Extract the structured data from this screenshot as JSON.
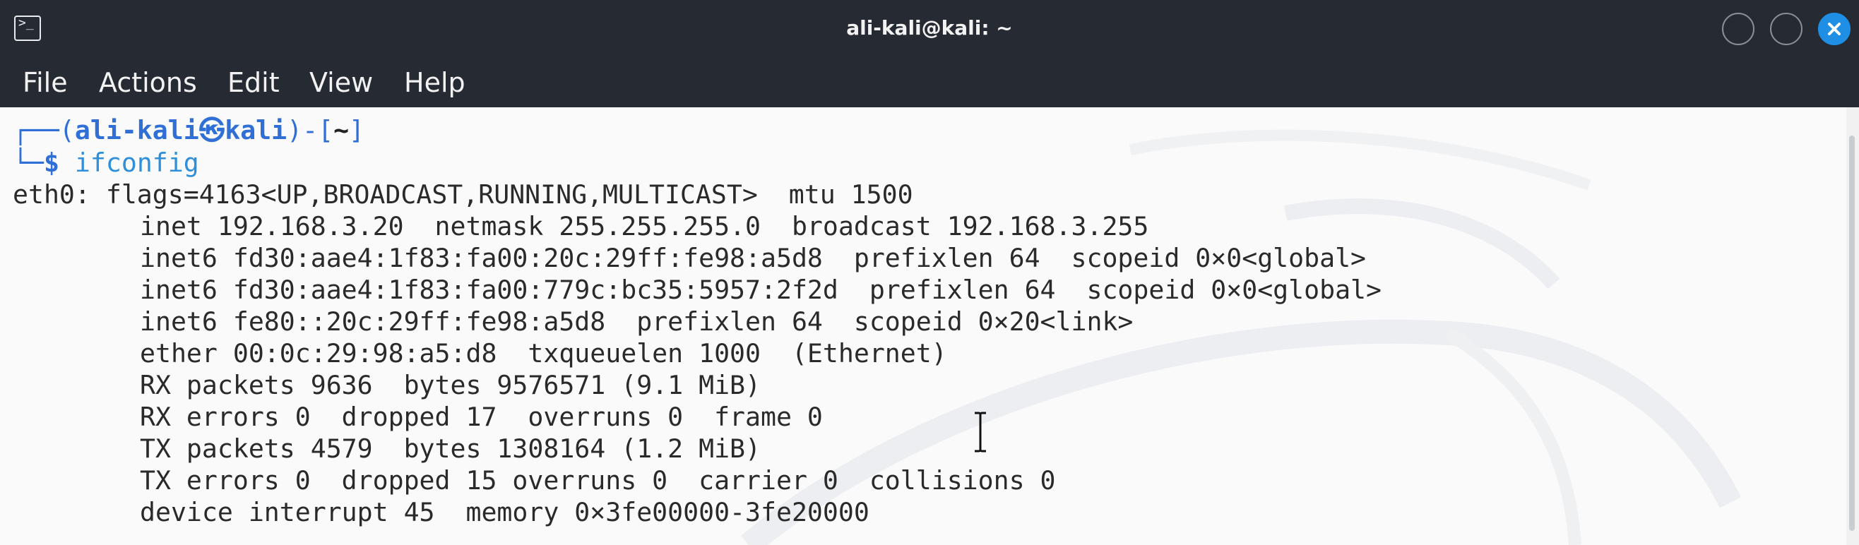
{
  "window": {
    "title": "ali-kali@kali: ~",
    "icon": "terminal-icon"
  },
  "menu": [
    "File",
    "Actions",
    "Edit",
    "View",
    "Help"
  ],
  "prompt": {
    "open": "┌──(",
    "user": "ali-kali",
    "at_symbol": "㉿",
    "host": "kali",
    "close_open": ")-[",
    "cwd": "~",
    "close": "]",
    "second_prefix": "└─",
    "dollar": "$",
    "command": "ifconfig"
  },
  "output": [
    "eth0: flags=4163<UP,BROADCAST,RUNNING,MULTICAST>  mtu 1500",
    "inet 192.168.3.20  netmask 255.255.255.0  broadcast 192.168.3.255",
    "inet6 fd30:aae4:1f83:fa00:20c:29ff:fe98:a5d8  prefixlen 64  scopeid 0×0<global>",
    "inet6 fd30:aae4:1f83:fa00:779c:bc35:5957:2f2d  prefixlen 64  scopeid 0×0<global>",
    "inet6 fe80::20c:29ff:fe98:a5d8  prefixlen 64  scopeid 0×20<link>",
    "ether 00:0c:29:98:a5:d8  txqueuelen 1000  (Ethernet)",
    "RX packets 9636  bytes 9576571 (9.1 MiB)",
    "RX errors 0  dropped 17  overruns 0  frame 0",
    "TX packets 4579  bytes 1308164 (1.2 MiB)",
    "TX errors 0  dropped 15 overruns 0  carrier 0  collisions 0",
    "device interrupt 45  memory 0×3fe00000-3fe20000"
  ],
  "colors": {
    "titlebar_bg": "#262a32",
    "terminal_bg": "#fafafb",
    "prompt_blue": "#2f6fd6",
    "close_button": "#1f8fe6"
  }
}
